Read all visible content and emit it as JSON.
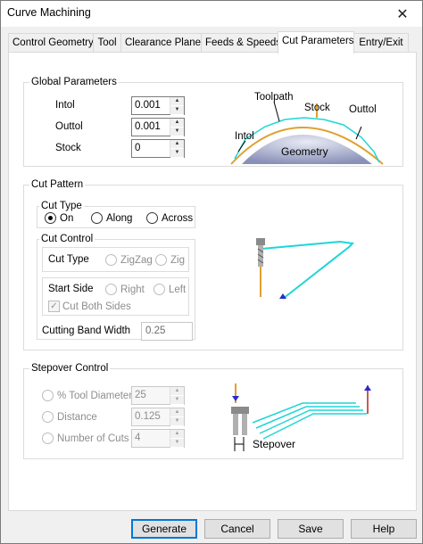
{
  "window": {
    "title": "Curve Machining",
    "close_glyph": "✕"
  },
  "tabs": [
    {
      "label": "Control Geometry"
    },
    {
      "label": "Tool"
    },
    {
      "label": "Clearance Plane"
    },
    {
      "label": "Feeds & Speeds"
    },
    {
      "label": "Cut Parameters",
      "active": true
    },
    {
      "label": "Entry/Exit"
    }
  ],
  "global_parameters": {
    "title": "Global Parameters",
    "intol_label": "Intol",
    "intol_value": "0.001",
    "outtol_label": "Outtol",
    "outtol_value": "0.001",
    "stock_label": "Stock",
    "stock_value": "0",
    "diagram": {
      "toolpath": "Toolpath",
      "stock": "Stock",
      "intol": "Intol",
      "outtol": "Outtol",
      "geometry": "Geometry"
    }
  },
  "cut_pattern": {
    "title": "Cut Pattern",
    "cut_type_title": "Cut Type",
    "options": [
      "On",
      "Along",
      "Across"
    ],
    "selected": "On",
    "cut_control": {
      "title": "Cut Control",
      "cut_type_label": "Cut Type",
      "zigzag": "ZigZag",
      "zig": "Zig",
      "start_side_label": "Start Side",
      "right": "Right",
      "left": "Left",
      "cut_both_sides": "Cut Both Sides",
      "cut_both_sides_mark": "✓",
      "band_width_label": "Cutting Band Width",
      "band_width_value": "0.25"
    }
  },
  "stepover_control": {
    "title": "Stepover Control",
    "tool_diameter_label": "% Tool Diameter",
    "tool_diameter_value": "25",
    "distance_label": "Distance",
    "distance_value": "0.125",
    "num_cuts_label": "Number of Cuts",
    "num_cuts_value": "4",
    "diagram_label": "Stepover"
  },
  "buttons": {
    "generate": "Generate",
    "cancel": "Cancel",
    "save": "Save",
    "help": "Help"
  },
  "arrows": {
    "up": "▲",
    "down": "▼"
  },
  "colors": {
    "toolpath": "#1fd6d6",
    "stock": "#e0a030",
    "accent": "#0078d7"
  }
}
